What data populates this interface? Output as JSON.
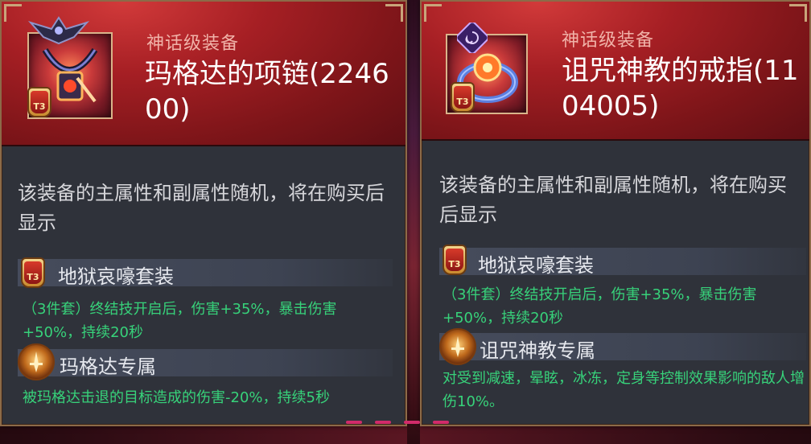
{
  "cards": [
    {
      "grade": "神话级装备",
      "name": "玛格达的项链(224600)",
      "description": "该装备的主属性和副属性随机，将在购买后显示",
      "tier_badge": "T3",
      "set": {
        "title": "地狱哀嚎套装",
        "effect": "（3件套）终结技开启后，伤害+35%，暴击伤害+50%，持续20秒"
      },
      "exclusive": {
        "title": "玛格达专属",
        "effect": "被玛格达击退的目标造成的伤害-20%，持续5秒"
      }
    },
    {
      "grade": "神话级装备",
      "name": "诅咒神教的戒指(1104005)",
      "description": "该装备的主属性和副属性随机，将在购买后显示",
      "tier_badge": "T3",
      "set": {
        "title": "地狱哀嚎套装",
        "effect": "（3件套）终结技开启后，伤害+35%，暴击伤害+50%，持续20秒"
      },
      "exclusive": {
        "title": "诅咒神教专属",
        "effect": "对受到减速，晕眩，冰冻，定身等控制效果影响的敌人增伤10%。"
      }
    }
  ],
  "colors": {
    "header_red": "#a61f24",
    "panel_bg": "#2f323a",
    "grade_text": "#f0b2a8",
    "effect_green": "#37d27a",
    "frame_gold": "#8c6a48"
  },
  "icons": [
    "demon-wing-emblem-icon",
    "necklace-item-icon",
    "swirl-emblem-icon",
    "ring-item-icon",
    "t3-tier-badge-icon",
    "sword-emblem-icon"
  ]
}
